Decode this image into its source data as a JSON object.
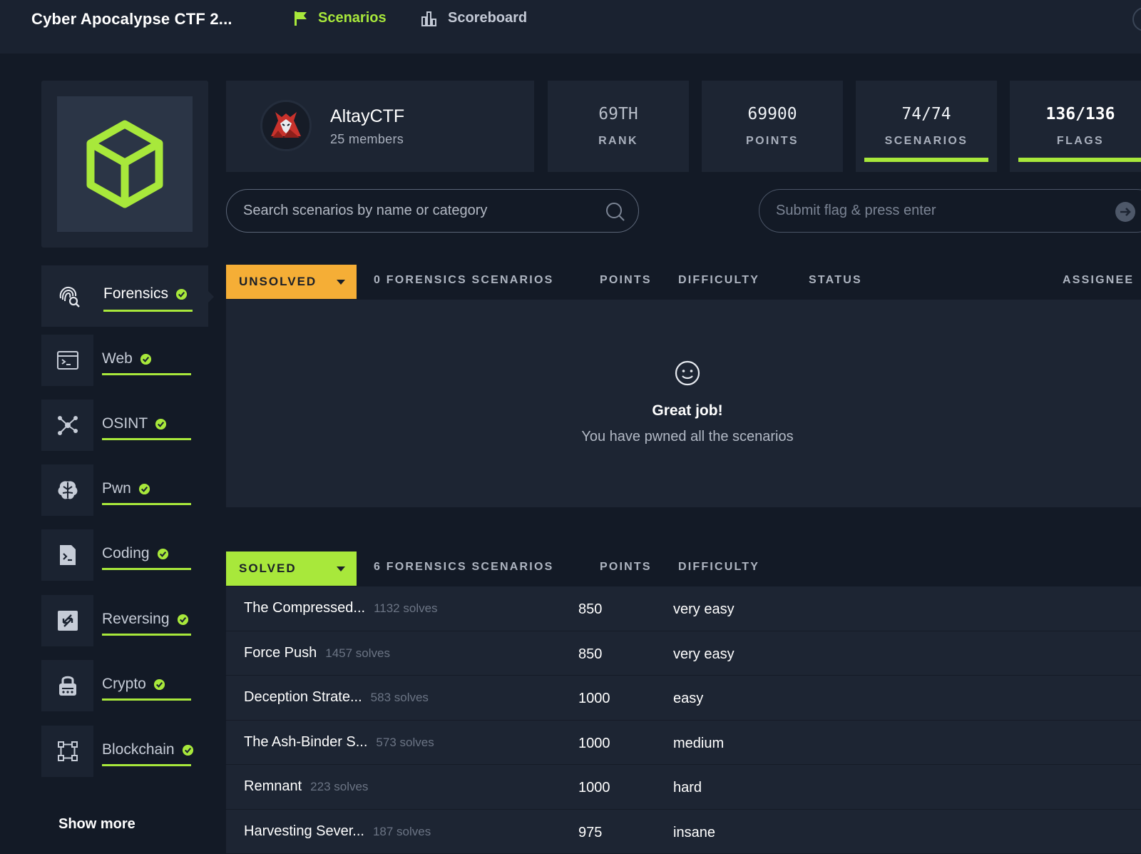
{
  "header": {
    "app_title": "Cyber Apocalypse CTF 2...",
    "nav": [
      {
        "label": "Scenarios",
        "icon": "flag-icon",
        "active": true
      },
      {
        "label": "Scoreboard",
        "icon": "bar-chart-icon",
        "active": false
      }
    ]
  },
  "team": {
    "name": "AltayCTF",
    "members": "25 members"
  },
  "stats": {
    "rank": {
      "value": "69TH",
      "label": "RANK"
    },
    "points": {
      "value": "69900",
      "label": "POINTS"
    },
    "scenarios": {
      "value": "74/74",
      "label": "SCENARIOS",
      "progress": 1.0
    },
    "flags": {
      "value": "136/136",
      "label": "FLAGS",
      "progress": 1.0
    }
  },
  "search": {
    "placeholder": "Search scenarios by name or category"
  },
  "flag_input": {
    "placeholder": "Submit flag & press enter"
  },
  "sidebar": {
    "items": [
      {
        "label": "Forensics",
        "icon": "fingerprint-search-icon",
        "completed": true,
        "active": true
      },
      {
        "label": "Web",
        "icon": "terminal-window-icon",
        "completed": true
      },
      {
        "label": "OSINT",
        "icon": "network-nodes-icon",
        "completed": true
      },
      {
        "label": "Pwn",
        "icon": "brain-icon",
        "completed": true
      },
      {
        "label": "Coding",
        "icon": "code-file-icon",
        "completed": true
      },
      {
        "label": "Reversing",
        "icon": "reverse-arrows-icon",
        "completed": true
      },
      {
        "label": "Crypto",
        "icon": "lock-icon",
        "completed": true
      },
      {
        "label": "Blockchain",
        "icon": "blockchain-icon",
        "completed": true
      }
    ],
    "show_more": "Show more"
  },
  "unsolved": {
    "filter_label": "UNSOLVED",
    "count_label": "0 FORENSICS SCENARIOS",
    "columns": {
      "points": "POINTS",
      "difficulty": "DIFFICULTY",
      "status": "STATUS",
      "assignee": "ASSIGNEE"
    },
    "empty_title": "Great job!",
    "empty_subtitle": "You have pwned all the scenarios"
  },
  "solved": {
    "filter_label": "SOLVED",
    "count_label": "6 FORENSICS SCENARIOS",
    "columns": {
      "points": "POINTS",
      "difficulty": "DIFFICULTY"
    },
    "rows": [
      {
        "name": "The Compressed...",
        "solves": "1132 solves",
        "points": "850",
        "difficulty": "very easy"
      },
      {
        "name": "Force Push",
        "solves": "1457 solves",
        "points": "850",
        "difficulty": "very easy"
      },
      {
        "name": "Deception Strate...",
        "solves": "583 solves",
        "points": "1000",
        "difficulty": "easy"
      },
      {
        "name": "The Ash-Binder S...",
        "solves": "573 solves",
        "points": "1000",
        "difficulty": "medium"
      },
      {
        "name": "Remnant",
        "solves": "223 solves",
        "points": "1000",
        "difficulty": "hard"
      },
      {
        "name": "Harvesting Sever...",
        "solves": "187 solves",
        "points": "975",
        "difficulty": "insane"
      }
    ]
  },
  "colors": {
    "accent": "#a8e83b",
    "unsolved": "#f5ae36",
    "background": "#131a26",
    "panel": "#1d2533"
  }
}
